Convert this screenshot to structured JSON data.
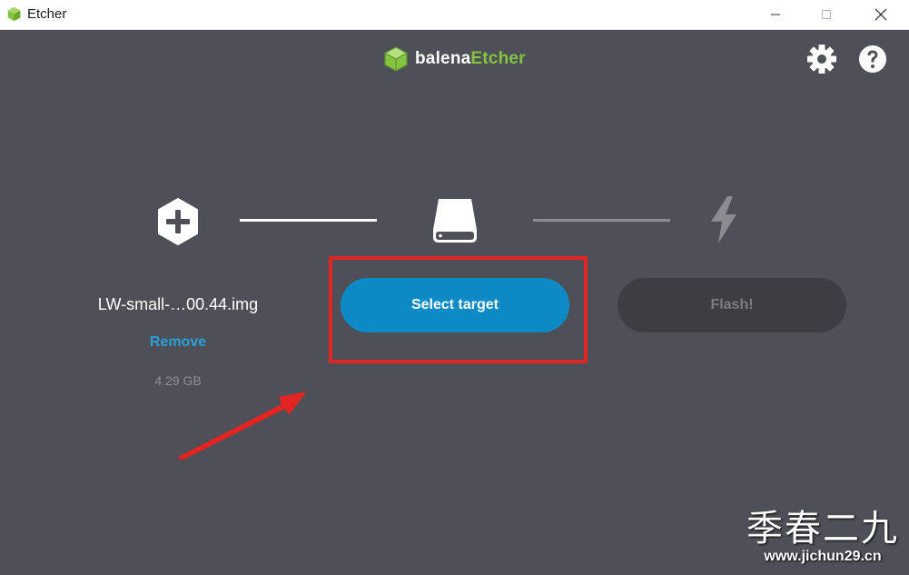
{
  "window": {
    "title": "Etcher",
    "controls": [
      "minimize",
      "maximize",
      "close"
    ]
  },
  "header": {
    "logo": {
      "icon": "cube-logo-icon",
      "text_part1": "balena",
      "text_part2": "Etcher",
      "accent_color": "#85c441"
    },
    "icons": [
      "settings-gear-icon",
      "help-question-icon"
    ]
  },
  "steps": {
    "source": {
      "icon": "plus-hexagon-icon",
      "filename": "LW-small-…00.44.img",
      "remove_label": "Remove",
      "size": "4.29 GB"
    },
    "target": {
      "icon": "drive-icon",
      "button_label": "Select target",
      "button_color": "#0c8bc7"
    },
    "flash": {
      "icon": "lightning-bolt-icon",
      "button_label": "Flash!",
      "enabled": false
    }
  },
  "annotations": {
    "highlight_color": "#e42323",
    "arrow": "red-arrow-pointing-to-select-target"
  },
  "watermark": {
    "chars": "季春二九",
    "url": "www.jichun29.cn"
  }
}
